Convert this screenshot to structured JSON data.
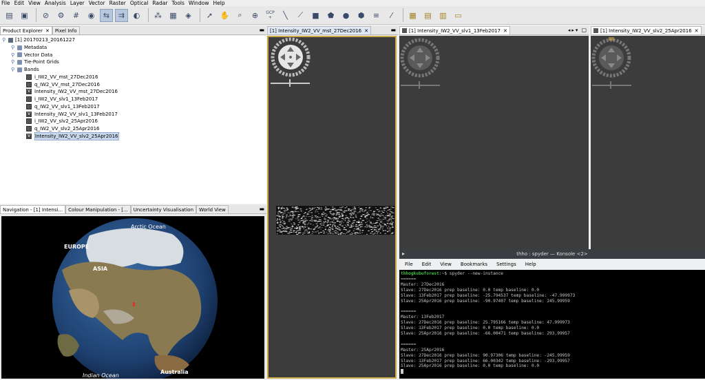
{
  "menubar": {
    "items": [
      "File",
      "Edit",
      "View",
      "Analysis",
      "Layer",
      "Vector",
      "Raster",
      "Optical",
      "Radar",
      "Tools",
      "Window",
      "Help"
    ]
  },
  "toolbar": {
    "icons": [
      "open-product-icon",
      "save-product-icon",
      "graph-builder-icon",
      "batch-icon",
      "band-maths-icon",
      "pan-icon",
      "zoom-icon",
      "sync-icon",
      "graph-icon",
      "grid-icon",
      "wifi-icon",
      "select-tool-icon",
      "pan-hand-icon",
      "zoom-tool-icon",
      "zoom-in-icon",
      "gcp-tool-icon",
      "line-tool-icon",
      "polyline-tool-icon",
      "rectangle-tool-icon",
      "polygon-tool-icon",
      "ellipse-tool-icon",
      "pin-tool-icon",
      "range-finder-icon",
      "magic-wand-icon",
      "tile-icon",
      "tile-horizontal-icon",
      "tile-vertical-icon",
      "open-folder-icon"
    ],
    "gcp_label": "GCP"
  },
  "product_explorer": {
    "tabs": [
      {
        "label": "Product Explorer"
      },
      {
        "label": "Pixel Info"
      }
    ],
    "product": "[1] 20170213_20161227",
    "folders": [
      "Metadata",
      "Vector Data",
      "Tie-Point Grids",
      "Bands"
    ],
    "bands": [
      {
        "name": "i_IW2_VV_mst_27Dec2016",
        "virtual": false
      },
      {
        "name": "q_IW2_VV_mst_27Dec2016",
        "virtual": false
      },
      {
        "name": "Intensity_IW2_VV_mst_27Dec2016",
        "virtual": true
      },
      {
        "name": "i_IW2_VV_slv1_13Feb2017",
        "virtual": false
      },
      {
        "name": "q_IW2_VV_slv1_13Feb2017",
        "virtual": false
      },
      {
        "name": "Intensity_IW2_VV_slv1_13Feb2017",
        "virtual": true
      },
      {
        "name": "i_IW2_VV_slv2_25Apr2016",
        "virtual": false
      },
      {
        "name": "q_IW2_VV_slv2_25Apr2016",
        "virtual": false
      },
      {
        "name": "Intensity_IW2_VV_slv2_25Apr2016",
        "virtual": true,
        "selected": true
      }
    ],
    "virtual_badge": "V"
  },
  "navigation": {
    "tabs": [
      {
        "label": "Navigation - [1] Intensi..."
      },
      {
        "label": "Colour Manipulation - [..."
      },
      {
        "label": "Uncertainty Visualisation"
      },
      {
        "label": "World View"
      }
    ],
    "globe_labels": {
      "arctic": "Arctic Ocean",
      "europe": "EUROPE",
      "asia": "ASIA",
      "indian": "Indian Ocean",
      "australia": "Australia"
    }
  },
  "image_views": [
    {
      "tab": "[1] Intensity_IW2_VV_mst_27Dec2016"
    },
    {
      "tab": "[1] Intensity_IW2_VV_slv1_13Feb2017"
    },
    {
      "tab": "[1] Intensity_IW2_VV_slv2_25Apr2016"
    }
  ],
  "terminal": {
    "title": "thho : spyder — Konsole <2>",
    "menu": [
      "File",
      "Edit",
      "View",
      "Bookmarks",
      "Settings",
      "Help"
    ],
    "prompt": "thhogkubuforest",
    "command": ":~$ spyder --new-instance",
    "lines": [
      "======",
      "Master: 27Dec2016",
      "Slave: 27Dec2016 prep baseline: 0.0 temp baseline: 0.0",
      "Slave: 13Feb2017 prep baseline: -25.794537 temp baseline: -47.999973",
      "Slave: 25Apr2016 prep baseline: -90.97407 temp baseline: 245.99959",
      "",
      "======",
      "Master: 13Feb2017",
      "Slave: 27Dec2016 prep baseline: 25.795166 temp baseline: 47.999973",
      "Slave: 13Feb2017 prep baseline: 0.0 temp baseline: 0.0",
      "Slave: 25Apr2016 prep baseline: -66.00471 temp baseline: 293.99957",
      "",
      "======",
      "Master: 25Apr2016",
      "Slave: 27Dec2016 prep baseline: 90.97306 temp baseline: -245.99959",
      "Slave: 13Feb2017 prep baseline: 66.00342 temp baseline: -293.99957",
      "Slave: 25Apr2016 prep baseline: 0.0 temp baseline: 0.0"
    ]
  },
  "colors": {
    "accent": "#c9a84a",
    "prompt": "#3fbf3f",
    "view_bg": "#3c3c3c"
  }
}
